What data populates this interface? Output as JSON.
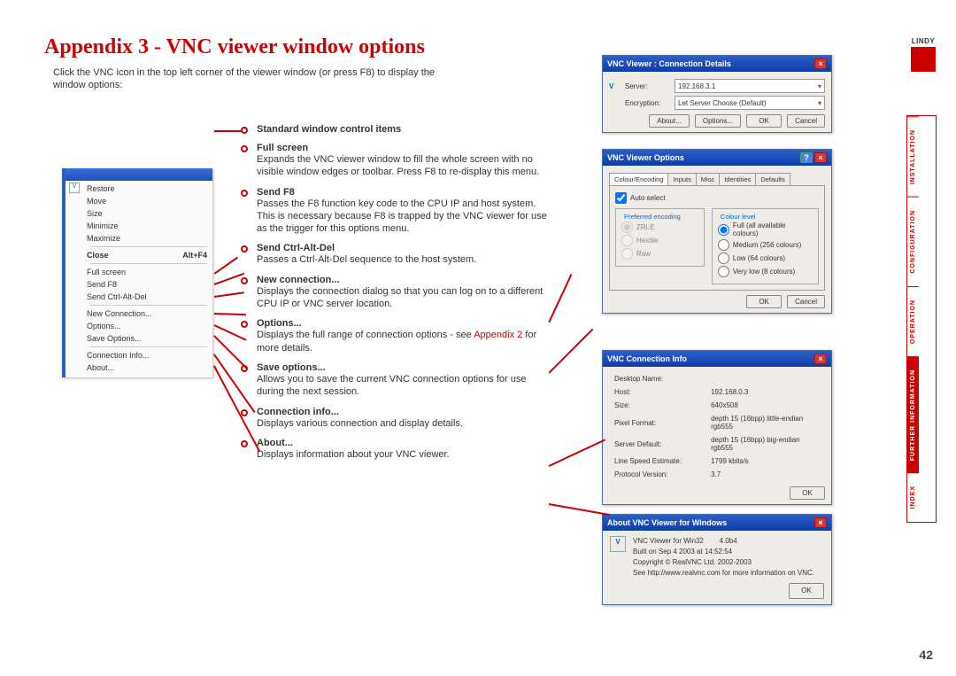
{
  "title": "Appendix 3 - VNC viewer window options",
  "intro": "Click the VNC icon in the top left corner of the viewer window (or press F8) to display the window options:",
  "brand": "LINDY",
  "pageNumber": "42",
  "sideTabs": [
    "INSTALLATION",
    "CONFIGURATION",
    "OPERATION",
    "FURTHER INFORMATION",
    "INDEX"
  ],
  "activeTab": 3,
  "menu": {
    "restore": "Restore",
    "move": "Move",
    "size": "Size",
    "minimize": "Minimize",
    "maximize": "Maximize",
    "close": "Close",
    "closeKey": "Alt+F4",
    "fullscreen": "Full screen",
    "sendF8": "Send F8",
    "sendCAD": "Send Ctrl-Alt-Del",
    "newConn": "New Connection...",
    "options": "Options...",
    "saveOptions": "Save Options...",
    "connInfo": "Connection Info...",
    "about": "About..."
  },
  "descs": [
    {
      "hd": "Standard window control items",
      "bd": ""
    },
    {
      "hd": "Full screen",
      "bd": "Expands the VNC viewer window to fill the whole screen with no visible window edges or toolbar. Press F8 to re-display this menu."
    },
    {
      "hd": "Send F8",
      "bd": "Passes the F8 function key code to the CPU IP and host system. This is necessary because F8 is trapped by the VNC viewer for use as the trigger for this options menu."
    },
    {
      "hd": "Send Ctrl-Alt-Del",
      "bd": "Passes a Ctrl-Alt-Del sequence to the host system."
    },
    {
      "hd": "New connection...",
      "bd": "Displays the connection dialog so that you can log on to a different CPU IP or VNC server location."
    },
    {
      "hd": "Options...",
      "bd": "Displays the full range of connection options - see ",
      "link": "Appendix 2",
      "bd2": " for more details."
    },
    {
      "hd": "Save options...",
      "bd": "Allows you to save the current VNC connection options for use during the next session."
    },
    {
      "hd": "Connection info...",
      "bd": "Displays various connection and display details."
    },
    {
      "hd": "About...",
      "bd": "Displays information about your VNC viewer."
    }
  ],
  "connDlg": {
    "title": "VNC Viewer : Connection Details",
    "serverLbl": "Server:",
    "serverVal": "192.168.3.1",
    "encLbl": "Encryption:",
    "encVal": "Let Server Choose (Default)",
    "btns": [
      "About...",
      "Options...",
      "OK",
      "Cancel"
    ]
  },
  "optDlg": {
    "title": "VNC Viewer Options",
    "tabs": [
      "Colour/Encoding",
      "Inputs",
      "Misc",
      "Identities",
      "Defaults"
    ],
    "autoSelect": "Auto select",
    "prefEnc": "Preferred encoding",
    "encOpts": [
      "ZRLE",
      "Hextile",
      "Raw"
    ],
    "clLegend": "Colour level",
    "clOpts": [
      "Full (all available colours)",
      "Medium (256 colours)",
      "Low (64 colours)",
      "Very low (8 colours)"
    ],
    "btns": [
      "OK",
      "Cancel"
    ]
  },
  "infoDlg": {
    "title": "VNC Connection Info",
    "rows": [
      [
        "Desktop Name:",
        ""
      ],
      [
        "Host:",
        "192.168.0.3"
      ],
      [
        "Size:",
        "640x508"
      ],
      [
        "Pixel Format:",
        "depth 15 (16bpp) little-endian rgb555"
      ],
      [
        "Server Default:",
        "depth 15 (16bpp) big-endian rgb555"
      ],
      [
        "Line Speed Estimate:",
        "1799 kbits/s"
      ],
      [
        "Protocol Version:",
        "3.7"
      ]
    ],
    "ok": "OK"
  },
  "aboutDlg": {
    "title": "About VNC Viewer for Windows",
    "l1a": "VNC Viewer for Win32",
    "l1b": "4.0b4",
    "l2": "Built on Sep 4 2003 at 14:52:54",
    "l3": "Copyright © RealVNC Ltd. 2002-2003",
    "l4": "See http://www.realvnc.com for more information on VNC.",
    "ok": "OK"
  }
}
